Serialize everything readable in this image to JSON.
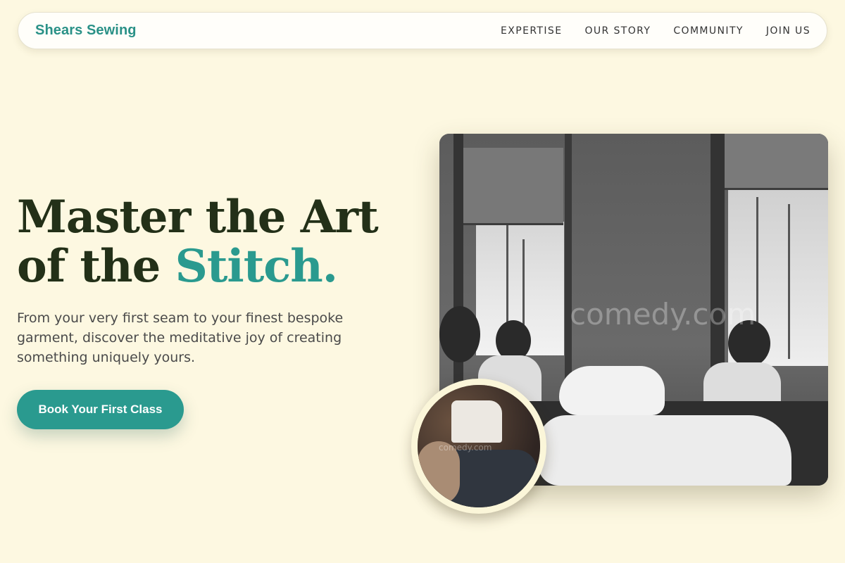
{
  "nav": {
    "brand": "Shears Sewing",
    "links": [
      "EXPERTISE",
      "OUR STORY",
      "COMMUNITY",
      "JOIN US"
    ]
  },
  "hero": {
    "title_line1": "Master the Art",
    "title_line2_start": "of the ",
    "title_accent": "Stitch.",
    "subtitle": "From your very first seam to your finest bespoke garment, discover the meditative joy of creating something uniquely yours.",
    "cta_label": "Book Your First Class"
  },
  "images": {
    "main_watermark": "comedy.com",
    "inset_watermark": "comedy.com"
  },
  "colors": {
    "background": "#fdf8e1",
    "accent": "#2a9a8f",
    "heading": "#233018"
  }
}
